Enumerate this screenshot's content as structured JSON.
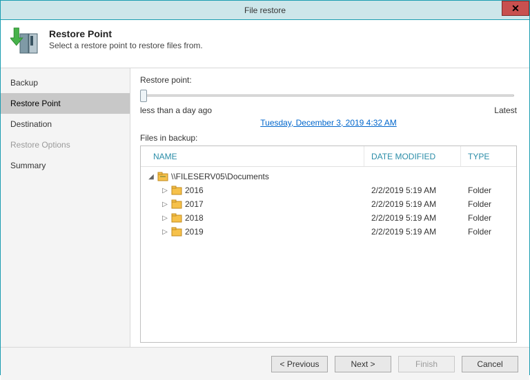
{
  "window": {
    "title": "File restore"
  },
  "header": {
    "title": "Restore Point",
    "subtitle": "Select a restore point to restore files from."
  },
  "sidebar": {
    "items": [
      {
        "label": "Backup",
        "active": false,
        "disabled": false
      },
      {
        "label": "Restore Point",
        "active": true,
        "disabled": false
      },
      {
        "label": "Destination",
        "active": false,
        "disabled": false
      },
      {
        "label": "Restore Options",
        "active": false,
        "disabled": true
      },
      {
        "label": "Summary",
        "active": false,
        "disabled": false
      }
    ]
  },
  "content": {
    "restore_point_label": "Restore point:",
    "slider_left": "less than a day ago",
    "slider_right": "Latest",
    "selected_point": "Tuesday, December 3, 2019 4:32 AM",
    "files_label": "Files in backup:",
    "columns": {
      "name": "NAME",
      "date": "DATE MODIFIED",
      "type": "TYPE"
    },
    "root": {
      "name": "\\\\FILESERV05\\Documents"
    },
    "rows": [
      {
        "name": "2016",
        "date": "2/2/2019 5:19 AM",
        "type": "Folder"
      },
      {
        "name": "2017",
        "date": "2/2/2019 5:19 AM",
        "type": "Folder"
      },
      {
        "name": "2018",
        "date": "2/2/2019 5:19 AM",
        "type": "Folder"
      },
      {
        "name": "2019",
        "date": "2/2/2019 5:19 AM",
        "type": "Folder"
      }
    ]
  },
  "buttons": {
    "previous": "< Previous",
    "next": "Next >",
    "finish": "Finish",
    "cancel": "Cancel"
  }
}
